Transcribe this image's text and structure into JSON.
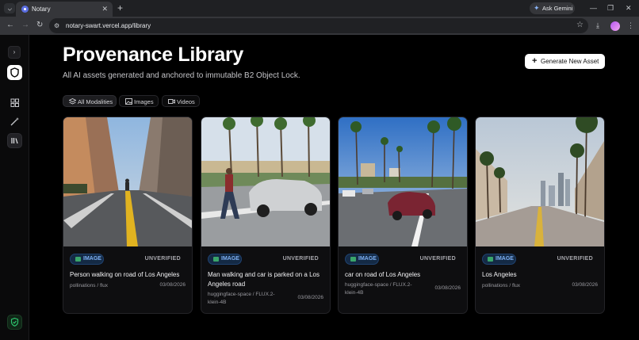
{
  "browser": {
    "tab_title": "Notary",
    "tab_close": "✕",
    "new_tab": "+",
    "ask_gemini": "Ask Gemini",
    "url": "notary-swart.vercel.app/library",
    "window_controls": [
      "—",
      "❐",
      "✕"
    ]
  },
  "app": {
    "sidebar": {
      "items": [
        {
          "icon": "shield-logo-icon"
        },
        {
          "icon": "dashboard-grid-icon"
        },
        {
          "icon": "magic-wand-icon"
        },
        {
          "icon": "library-icon",
          "active": true
        },
        {
          "icon": "verified-shield-icon"
        }
      ]
    },
    "header": {
      "title": "Provenance Library",
      "subtitle": "All AI assets generated and anchored to immutable B2 Object Lock.",
      "generate_button": "Generate New Asset"
    },
    "filters": [
      {
        "label": "All Modalities",
        "icon": "layers-icon",
        "active": true
      },
      {
        "label": "Images",
        "icon": "image-icon",
        "active": false
      },
      {
        "label": "Videos",
        "icon": "video-icon",
        "active": false
      }
    ],
    "assets": [
      {
        "type": "IMAGE",
        "status": "UNVERIFIED",
        "title": "Person walking on road of Los Angeles",
        "source": "pollinations / flux",
        "date": "03/08/2026"
      },
      {
        "type": "IMAGE",
        "status": "UNVERIFIED",
        "title": "Man walking and car is parked on a Los Angeles road",
        "source": "huggingface-space / FLUX.2-klein-4B",
        "date": "03/08/2026"
      },
      {
        "type": "IMAGE",
        "status": "UNVERIFIED",
        "title": "car on road of Los Angeles",
        "source": "huggingface-space / FLUX.2-klein-4B",
        "date": "03/08/2026"
      },
      {
        "type": "IMAGE",
        "status": "UNVERIFIED",
        "title": "Los Angeles",
        "source": "pollinations / flux",
        "date": "03/08/2026"
      }
    ]
  },
  "colors": {
    "background": "#000000",
    "badge_bg": "#142a45",
    "badge_text": "#7fb2f5",
    "verified_green": "#2ecc71"
  }
}
